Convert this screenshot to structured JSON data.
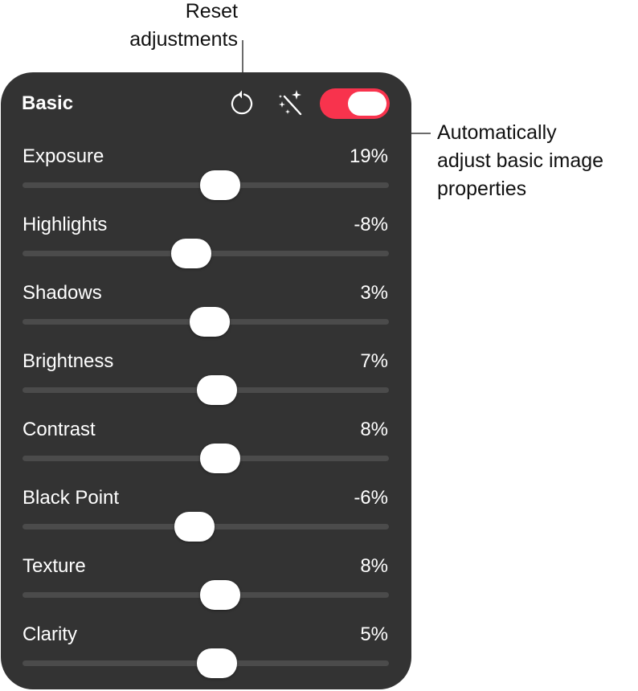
{
  "callouts": {
    "reset": "Reset\nadjustments",
    "auto": "Automatically\nadjust basic image\nproperties"
  },
  "panel": {
    "title": "Basic",
    "toggle_on": true,
    "toggle_color": "#f8334d",
    "background_color": "#333333",
    "icons": {
      "reset": "reset-adjustments-icon",
      "auto": "magic-wand-icon"
    }
  },
  "adjustments": [
    {
      "label": "Exposure",
      "value": "19%",
      "position": 0.54
    },
    {
      "label": "Highlights",
      "value": "-8%",
      "position": 0.46
    },
    {
      "label": "Shadows",
      "value": "3%",
      "position": 0.51
    },
    {
      "label": "Brightness",
      "value": "7%",
      "position": 0.53
    },
    {
      "label": "Contrast",
      "value": "8%",
      "position": 0.54
    },
    {
      "label": "Black Point",
      "value": "-6%",
      "position": 0.47
    },
    {
      "label": "Texture",
      "value": "8%",
      "position": 0.54
    },
    {
      "label": "Clarity",
      "value": "5%",
      "position": 0.53
    }
  ]
}
